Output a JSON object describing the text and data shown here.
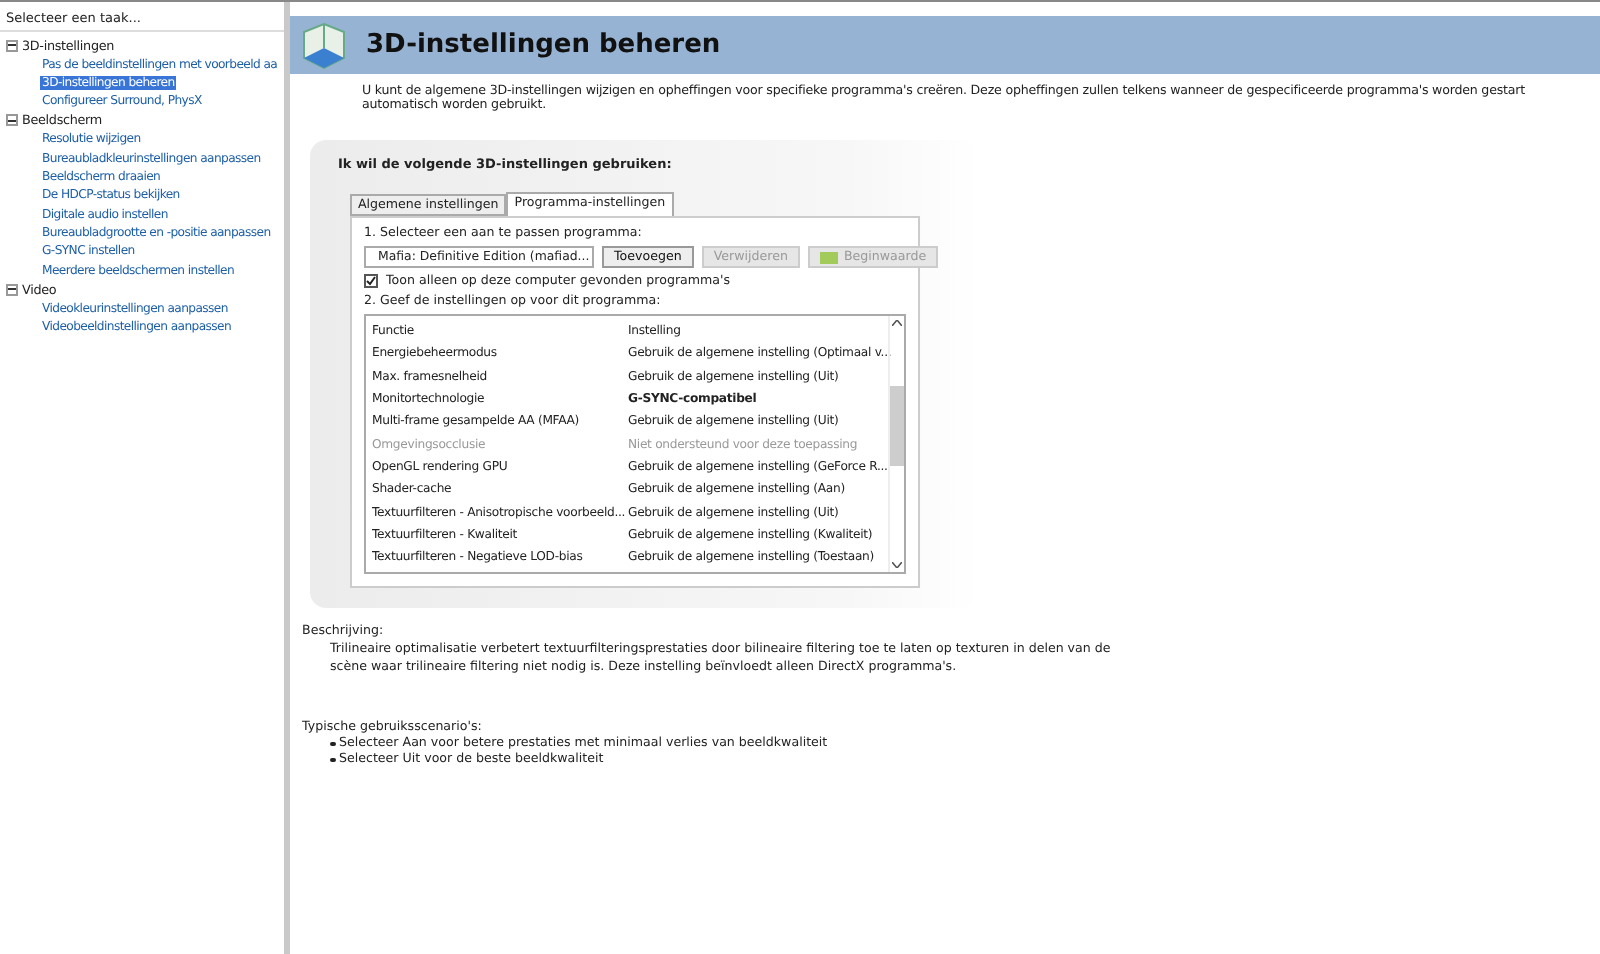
{
  "sidebar": {
    "title": "Selecteer een taak...",
    "tree": [
      {
        "label": "3D-instellingen",
        "expanded": true,
        "selected": false,
        "children": [
          {
            "label": "Pas de beeldinstellingen met voorbeeld aa",
            "selected": false
          },
          {
            "label": "3D-instellingen beheren",
            "selected": true
          },
          {
            "label": "Configureer Surround, PhysX",
            "selected": false
          }
        ]
      },
      {
        "label": "Beeldscherm",
        "expanded": true,
        "selected": false,
        "children": [
          {
            "label": "Resolutie wijzigen",
            "selected": false
          },
          {
            "label": "Bureaubladkleurinstellingen aanpassen",
            "selected": false
          },
          {
            "label": "Beeldscherm draaien",
            "selected": false
          },
          {
            "label": "De HDCP-status bekijken",
            "selected": false
          },
          {
            "label": "Digitale audio instellen",
            "selected": false
          },
          {
            "label": "Bureaubladgrootte en -positie aanpassen",
            "selected": false
          },
          {
            "label": "G-SYNC instellen",
            "selected": false
          },
          {
            "label": "Meerdere beeldschermen instellen",
            "selected": false
          }
        ]
      },
      {
        "label": "Video",
        "expanded": true,
        "selected": false,
        "children": [
          {
            "label": "Videokleurinstellingen aanpassen",
            "selected": false
          },
          {
            "label": "Videobeeldinstellingen aanpassen",
            "selected": false
          }
        ]
      }
    ]
  },
  "header": {
    "title": "3D-instellingen beheren"
  },
  "intro": "U kunt de algemene 3D-instellingen wijzigen en opheffingen voor specifieke programma's creëren. Deze opheffingen zullen telkens wanneer de gespecificeerde programma's worden gestart automatisch worden gebruikt.",
  "panel": {
    "title": "Ik wil de volgende 3D-instellingen gebruiken:",
    "tabs": [
      {
        "label": "Algemene instellingen",
        "selected": false
      },
      {
        "label": "Programma-instellingen",
        "selected": true
      }
    ],
    "step1": "1. Selecteer een aan te passen programma:",
    "program": "Mafia: Definitive Edition (mafiad...",
    "buttons": [
      {
        "label": "Toevoegen",
        "disabled": false,
        "icon": false
      },
      {
        "label": "Verwijderen",
        "disabled": true,
        "icon": false
      },
      {
        "label": "Beginwaarde",
        "disabled": true,
        "icon": true
      }
    ],
    "only_found": {
      "label": "Toon alleen op deze computer gevonden programma's",
      "checked": true
    },
    "step2": "2. Geef de instellingen op voor dit programma:",
    "columns": [
      "Functie",
      "Instelling"
    ],
    "rows": [
      {
        "feature": "Energiebeheermodus",
        "setting": "Gebruik de algemene instelling (Optimaal v...",
        "disabled": false,
        "overridden": false
      },
      {
        "feature": "Max. framesnelheid",
        "setting": "Gebruik de algemene instelling (Uit)",
        "disabled": false,
        "overridden": false
      },
      {
        "feature": "Monitortechnologie",
        "setting": "G-SYNC-compatibel",
        "disabled": false,
        "overridden": true
      },
      {
        "feature": "Multi-frame gesampelde AA (MFAA)",
        "setting": "Gebruik de algemene instelling (Uit)",
        "disabled": false,
        "overridden": false
      },
      {
        "feature": "Omgevingsocclusie",
        "setting": "Niet ondersteund voor deze toepassing",
        "disabled": true,
        "overridden": false
      },
      {
        "feature": "OpenGL rendering GPU",
        "setting": "Gebruik de algemene instelling (GeForce R...",
        "disabled": false,
        "overridden": false
      },
      {
        "feature": "Shader-cache",
        "setting": "Gebruik de algemene instelling (Aan)",
        "disabled": false,
        "overridden": false
      },
      {
        "feature": "Textuurfilteren - Anisotropische voorbeeld...",
        "setting": "Gebruik de algemene instelling (Uit)",
        "disabled": false,
        "overridden": false
      },
      {
        "feature": "Textuurfilteren - Kwaliteit",
        "setting": "Gebruik de algemene instelling (Kwaliteit)",
        "disabled": false,
        "overridden": false
      },
      {
        "feature": "Textuurfilteren - Negatieve LOD-bias",
        "setting": "Gebruik de algemene instelling (Toestaan)",
        "disabled": false,
        "overridden": false
      }
    ]
  },
  "description": {
    "label": "Beschrijving:",
    "text": "Trilineaire optimalisatie verbetert textuurfilteringsprestaties door bilineaire filtering toe te laten op texturen in delen van de scène waar trilineaire filtering niet nodig is. Deze instelling beïnvloedt alleen DirectX programma's."
  },
  "usage": {
    "label": "Typische gebruiksscenario's:",
    "items": [
      "Selecteer Aan voor betere prestaties met minimaal verlies van beeldkwaliteit",
      "Selecteer Uit voor de beste beeldkwaliteit"
    ]
  }
}
